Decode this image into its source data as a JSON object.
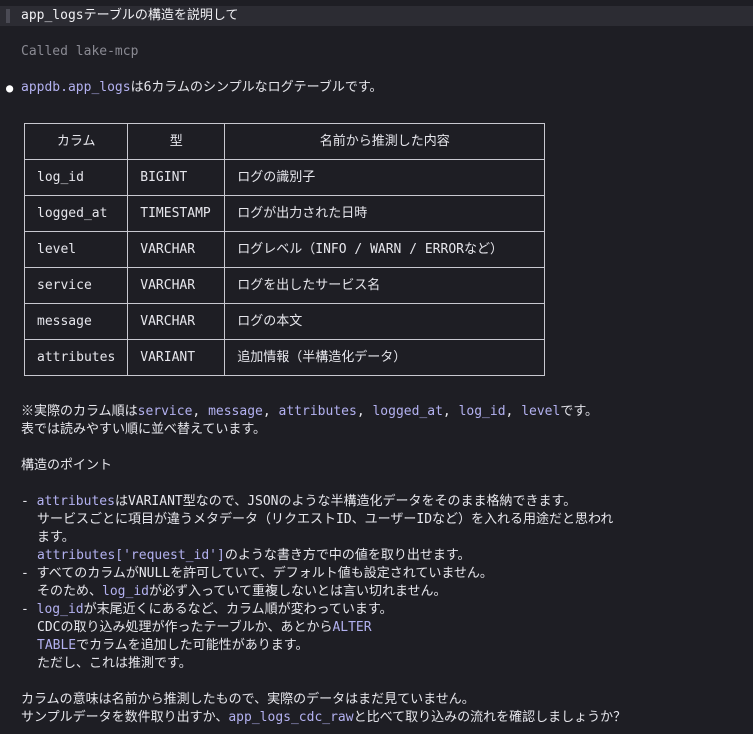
{
  "prompt": {
    "text": "app_logsテーブルの構造を説明して"
  },
  "tool_call": {
    "text": "Called lake-mcp"
  },
  "summary": {
    "table_name": "appdb.app_logs",
    "text": "は6カラムのシンプルなログテーブルです。"
  },
  "table": {
    "headers": [
      "カラム",
      "型",
      "名前から推測した内容"
    ],
    "rows": [
      {
        "column": "log_id",
        "type": "BIGINT",
        "meaning": "ログの識別子"
      },
      {
        "column": "logged_at",
        "type": "TIMESTAMP",
        "meaning": "ログが出力された日時"
      },
      {
        "column": "level",
        "type": "VARCHAR",
        "meaning": "ログレベル（INFO / WARN / ERRORなど）"
      },
      {
        "column": "service",
        "type": "VARCHAR",
        "meaning": "ログを出したサービス名"
      },
      {
        "column": "message",
        "type": "VARCHAR",
        "meaning": "ログの本文"
      },
      {
        "column": "attributes",
        "type": "VARIANT",
        "meaning": "追加情報（半構造化データ）"
      }
    ]
  },
  "order_note": {
    "prefix": "※実際のカラム順は",
    "c1": "service",
    "sep1": ", ",
    "c2": "message",
    "sep2": ", ",
    "c3": "attributes",
    "sep3": ", ",
    "c4": "logged_at",
    "sep4": ", ",
    "c5": "log_id",
    "sep5": ", ",
    "c6": "level",
    "suffix": "です。",
    "line2": "表では読みやすい順に並べ替えています。"
  },
  "points": {
    "heading": "構造のポイント",
    "p1_dash": "- ",
    "p1_code": "attributes",
    "p1_text": "はVARIANT型なので、JSONのような半構造化データをそのまま格納できます。",
    "p1_line2": "サービスごとに項目が違うメタデータ（リクエストID、ユーザーIDなど）を入れる用途だと思われ",
    "p1_line3": "ます。",
    "p1_code2": "attributes['request_id']",
    "p1_line4": "のような書き方で中の値を取り出せます。",
    "p2_line1": "- すべてのカラムがNULLを許可していて、デフォルト値も設定されていません。",
    "p2_pre": "そのため、",
    "p2_code": "log_id",
    "p2_post": "が必ず入っていて重複しないとは言い切れません。",
    "p3_dash": "- ",
    "p3_code": "log_id",
    "p3_text": "が末尾近くにあるなど、カラム順が変わっています。",
    "p3_pre": "CDCの取り込み処理が作ったテーブルか、あとから",
    "p3_code2": "ALTER",
    "p3_code3": "TABLE",
    "p3_post": "でカラムを追加した可能性があります。",
    "p3_line4": "ただし、これは推測です。"
  },
  "closing": {
    "line1": "カラムの意味は名前から推測したもので、実際のデータはまだ見ていません。",
    "pre": "サンプルデータを数件取り出すか、",
    "code": "app_logs_cdc_raw",
    "post": "と比べて取り込みの流れを確認しましょうか？"
  },
  "colors": {
    "background": "#1e1e24",
    "prompt_bar": "#2c2c33",
    "code": "#b3b1f0",
    "muted": "#8a8a93",
    "text": "#e6e6ec"
  }
}
